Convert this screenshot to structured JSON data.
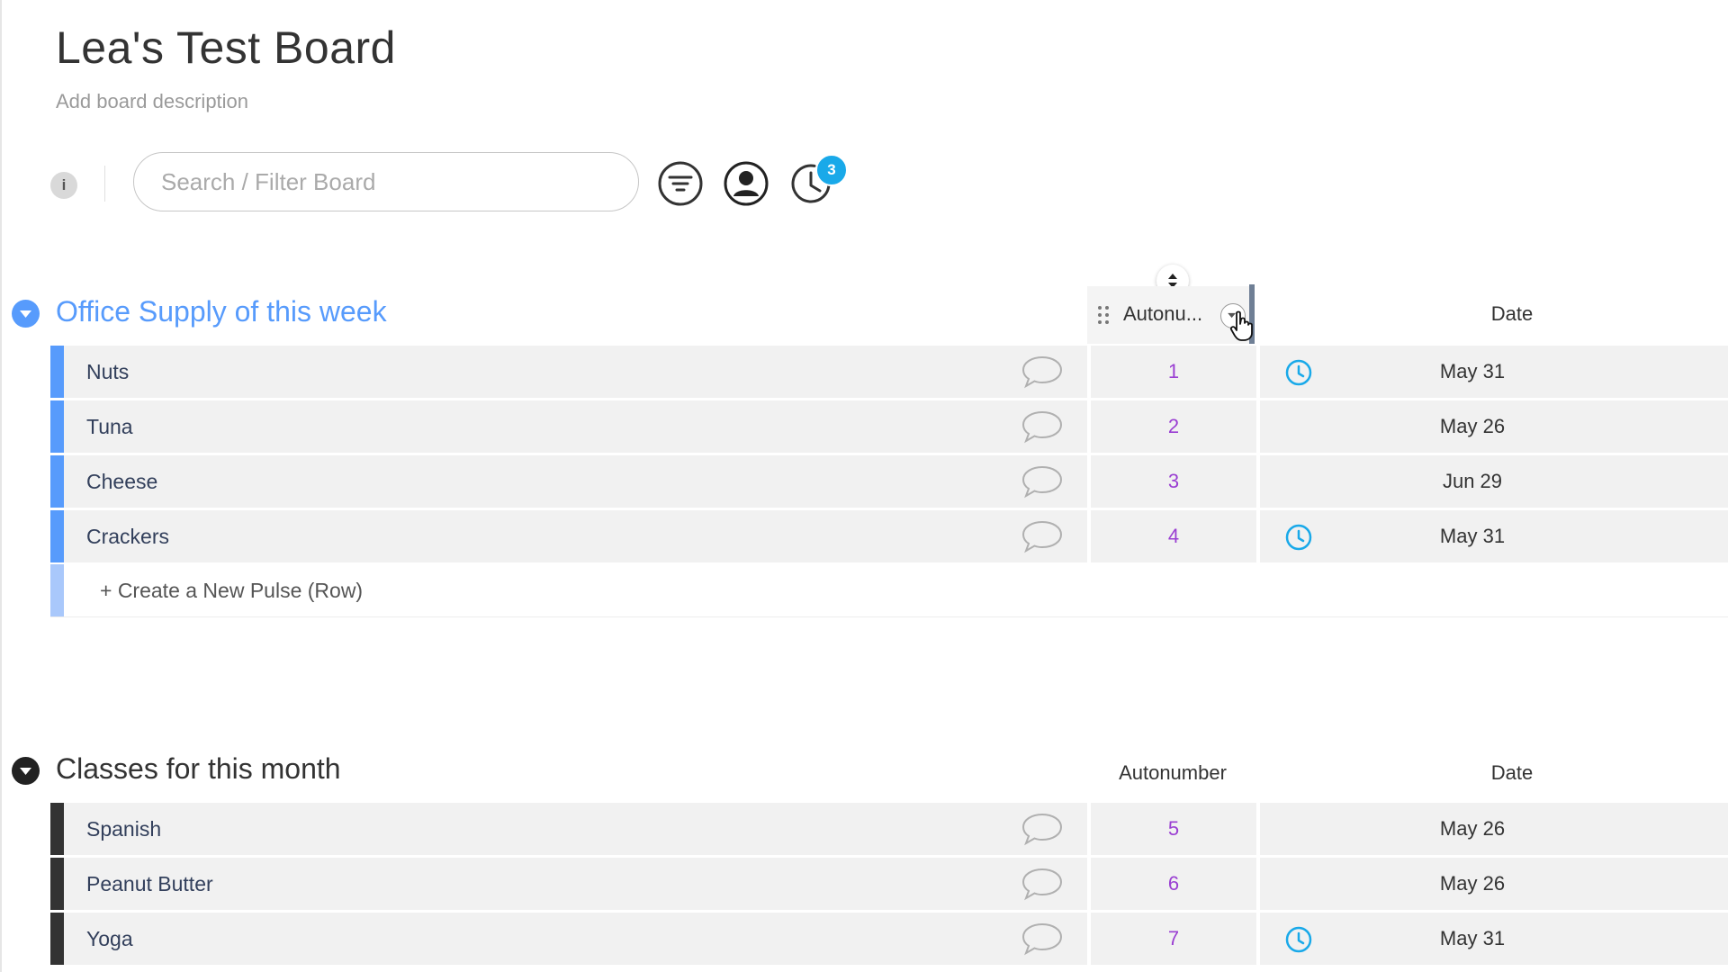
{
  "board": {
    "title": "Lea's Test Board",
    "description": "Add board description"
  },
  "toolbar": {
    "info_icon": "info-icon",
    "search_placeholder": "Search / Filter Board",
    "tools": [
      "filter-icon",
      "person-icon",
      "activity-icon"
    ],
    "activity_badge": "3"
  },
  "colors": {
    "group1_accent": "#579bfc",
    "group2_accent": "#333333",
    "autonumber_text": "#9a3fd2",
    "clock_icon": "#19a9e9",
    "badge": "#19a9e9"
  },
  "groups": [
    {
      "title": "Office Supply of this week",
      "columns": {
        "autonumber": "Autonu...",
        "date": "Date"
      },
      "rows": [
        {
          "name": "Nuts",
          "number": "1",
          "date": "May 31",
          "reminder": true
        },
        {
          "name": "Tuna",
          "number": "2",
          "date": "May 26",
          "reminder": false
        },
        {
          "name": "Cheese",
          "number": "3",
          "date": "Jun 29",
          "reminder": false
        },
        {
          "name": "Crackers",
          "number": "4",
          "date": "May 31",
          "reminder": true
        }
      ],
      "new_row_label": "+ Create a New Pulse (Row)"
    },
    {
      "title": "Classes for this month",
      "columns": {
        "autonumber": "Autonumber",
        "date": "Date"
      },
      "rows": [
        {
          "name": "Spanish",
          "number": "5",
          "date": "May 26",
          "reminder": false
        },
        {
          "name": "Peanut Butter",
          "number": "6",
          "date": "May 26",
          "reminder": false
        },
        {
          "name": "Yoga",
          "number": "7",
          "date": "May 31",
          "reminder": true
        }
      ]
    }
  ]
}
